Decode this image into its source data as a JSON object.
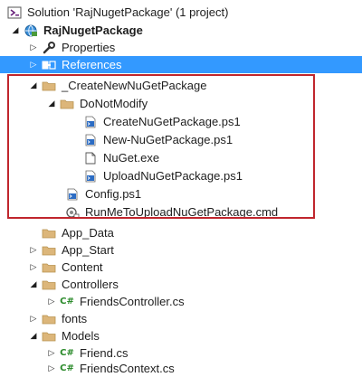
{
  "tree": {
    "solution": "Solution 'RajNugetPackage' (1 project)",
    "project": "RajNugetPackage",
    "properties": "Properties",
    "references": "References",
    "create_folder": "_CreateNewNuGetPackage",
    "donotmodify": "DoNotModify",
    "create_ps1": "CreateNuGetPackage.ps1",
    "new_ps1": "New-NuGetPackage.ps1",
    "nuget_exe": "NuGet.exe",
    "upload_ps1": "UploadNuGetPackage.ps1",
    "config_ps1": "Config.ps1",
    "run_cmd": "RunMeToUploadNuGetPackage.cmd",
    "app_data": "App_Data",
    "app_start": "App_Start",
    "content": "Content",
    "controllers": "Controllers",
    "friends_controller": "FriendsController.cs",
    "fonts": "fonts",
    "models": "Models",
    "friend_cs": "Friend.cs",
    "friends_context": "FriendsContext.cs",
    "cs_glyph": "C#"
  },
  "colors": {
    "selection": "#3399ff",
    "highlight_border": "#c0262d",
    "folder": "#dcb67a",
    "csharp": "#2a8a2a"
  },
  "icons": {
    "solution": "solution-icon",
    "project": "web-project-icon",
    "properties": "wrench-icon",
    "references": "references-icon",
    "folder": "folder-icon",
    "script": "powershell-script-icon",
    "file": "file-icon",
    "cmd": "cmd-script-icon",
    "csharp": "csharp-file-icon"
  }
}
